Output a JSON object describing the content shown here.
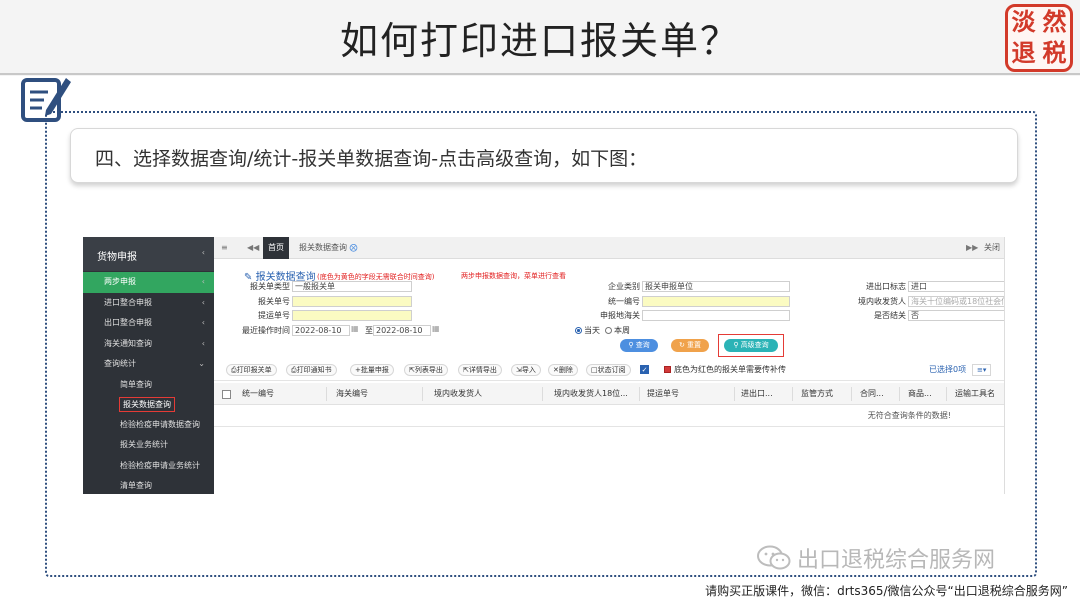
{
  "slide": {
    "title": "如何打印进口报关单？",
    "seal_chars": [
      "淡",
      "然",
      "退",
      "税"
    ],
    "step": "四、选择数据查询/统计-报关单数据查询-点击高级查询，如下图：",
    "footer": "请购买正版课件，微信：drts365/微信公众号“出口退税综合服务网”",
    "watermark": "出口退税综合服务网",
    "colors": {
      "accent": "#2f4f7f",
      "seal": "#d23a2a"
    }
  },
  "icons": {
    "note": "note-edit-icon",
    "wechat": "wechat-icon",
    "menu": "hamburger-icon",
    "nav_prev": "double-left-arrow-icon",
    "nav_next": "double-right-arrow-icon",
    "tab_close": "close-circle-icon"
  },
  "app": {
    "sidebar": {
      "header": "货物申报",
      "items": [
        {
          "label": "两步申报",
          "active": true
        },
        {
          "label": "进口整合申报"
        },
        {
          "label": "出口整合申报"
        },
        {
          "label": "海关通知查询"
        },
        {
          "label": "查询统计",
          "expanded": true
        }
      ],
      "subitems": [
        {
          "label": "简单查询"
        },
        {
          "label": "报关数据查询",
          "selected": true
        },
        {
          "label": "检验检疫申请数据查询"
        },
        {
          "label": "报关业务统计"
        },
        {
          "label": "检验检疫申请业务统计"
        },
        {
          "label": "清单查询"
        }
      ]
    },
    "tabs": {
      "home": "首页",
      "current": "报关数据查询",
      "close_all": "关闭"
    },
    "form": {
      "title": "报关数据查询",
      "hint": "(底色为黄色的字段无需联合时间查询)",
      "notice": "两步申报数据查询，菜单进行查看",
      "fields": {
        "decl_type": {
          "label": "报关单类型",
          "value": "一般报关单"
        },
        "decl_no": {
          "label": "报关单号",
          "value": ""
        },
        "bill_no": {
          "label": "提运单号",
          "value": ""
        },
        "date_range": {
          "label": "最近操作时间",
          "from": "2022-08-10",
          "sep": "至",
          "to": "2022-08-10"
        },
        "corp_type": {
          "label": "企业类别",
          "value": "报关申报单位"
        },
        "unified_no": {
          "label": "统一编号",
          "value": ""
        },
        "customs": {
          "label": "申报地海关",
          "value": ""
        },
        "ie_flag": {
          "label": "进出口标志",
          "value": "进口"
        },
        "consignee": {
          "label": "境内收发货人",
          "placeholder": "海关十位编码或18位社会信用代码"
        },
        "finished": {
          "label": "是否结关",
          "value": "否"
        }
      },
      "radios": {
        "today": "当天",
        "week": "本周",
        "selected": "today"
      },
      "buttons": {
        "query": "查询",
        "reset": "重置",
        "advanced": "高级查询"
      }
    },
    "toolbar": {
      "buttons": [
        "打印报关单",
        "打印通知书",
        "批量申报",
        "列表导出",
        "详情导出",
        "导入",
        "删除",
        "状态订阅"
      ],
      "red_hint": "底色为红色的报关单需要传补传",
      "selected": "已选择0项"
    },
    "grid": {
      "columns": [
        "统一编号",
        "海关编号",
        "境内收发货人",
        "境内收发货人18位...",
        "提运单号",
        "进出口...",
        "监管方式",
        "合同...",
        "商品...",
        "运输工具名"
      ],
      "empty_text": "无符合查询条件的数据!"
    }
  }
}
